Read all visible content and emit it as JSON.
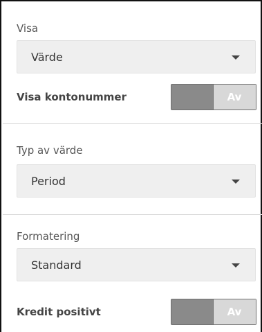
{
  "show_section": {
    "label": "Visa",
    "select_value": "Värde",
    "toggle_label": "Visa kontonummer",
    "toggle_state": "Av"
  },
  "value_type_section": {
    "label": "Typ av värde",
    "select_value": "Period"
  },
  "formatting_section": {
    "label": "Formatering",
    "select_value": "Standard",
    "toggle_label": "Kredit positivt",
    "toggle_state": "Av"
  },
  "icons": {
    "dropdown": "chevron-down-icon"
  }
}
